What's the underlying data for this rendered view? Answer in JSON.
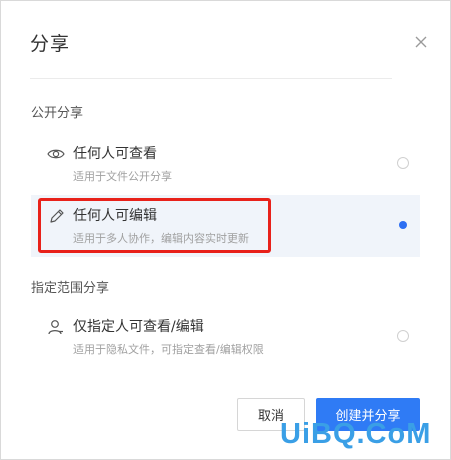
{
  "dialog": {
    "title": "分享",
    "close_icon": "close-icon"
  },
  "public_section": {
    "label": "公开分享",
    "options": [
      {
        "title": "任何人可查看",
        "desc": "适用于文件公开分享",
        "icon": "eye-icon",
        "selected": false
      },
      {
        "title": "任何人可编辑",
        "desc": "适用于多人协作，编辑内容实时更新",
        "icon": "pencil-icon",
        "selected": true
      }
    ]
  },
  "scoped_section": {
    "label": "指定范围分享",
    "options": [
      {
        "title": "仅指定人可查看/编辑",
        "desc": "适用于隐私文件，可指定查看/编辑权限",
        "icon": "user-icon",
        "selected": false
      }
    ]
  },
  "footer": {
    "cancel_label": "取消",
    "create_label": "创建并分享"
  },
  "watermark": "UiBQ.CoM",
  "colors": {
    "primary": "#2f7bf5",
    "highlight_box": "#e8211a",
    "selected_bg": "#f0f4fa"
  }
}
